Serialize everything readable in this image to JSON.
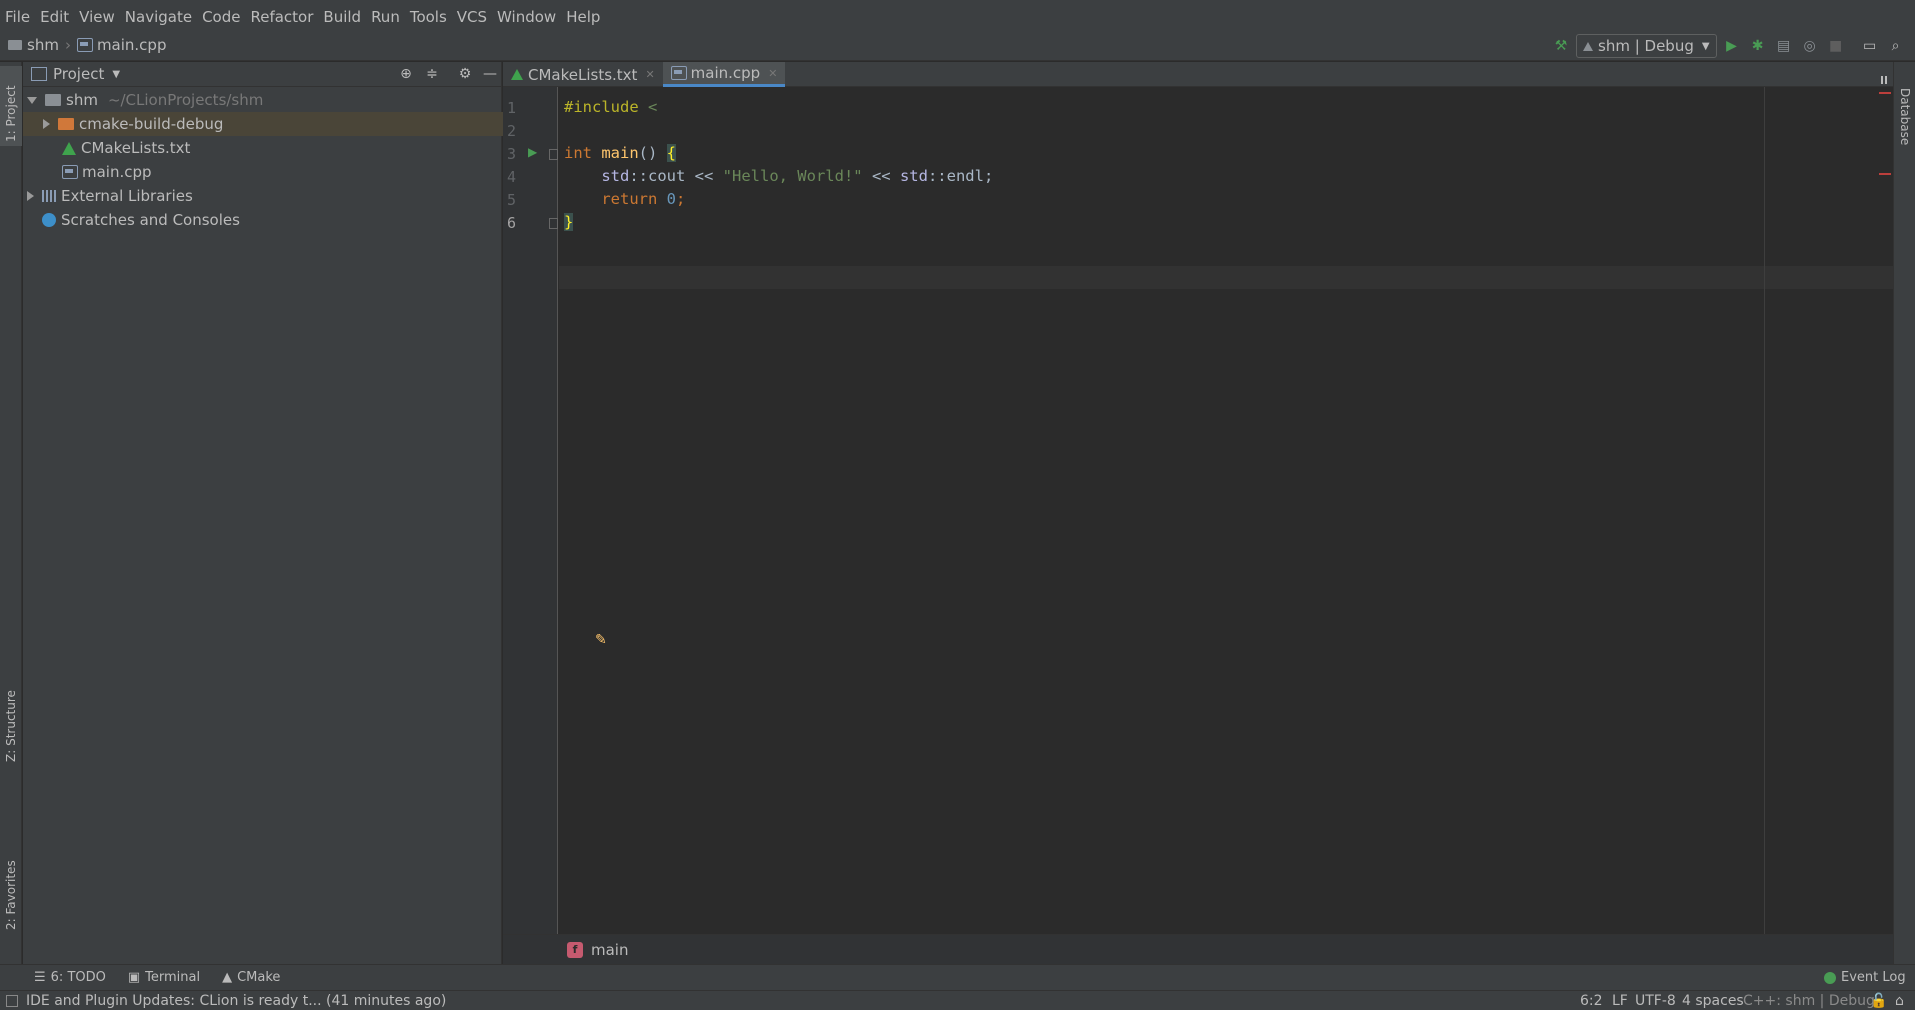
{
  "menu": [
    "File",
    "Edit",
    "View",
    "Navigate",
    "Code",
    "Refactor",
    "Build",
    "Run",
    "Tools",
    "VCS",
    "Window",
    "Help"
  ],
  "breadcrumb": {
    "project": "shm",
    "file": "main.cpp"
  },
  "run_config": "shm | Debug",
  "side_tabs": {
    "project": "1: Project",
    "structure": "Z: Structure",
    "favorites": "2: Favorites",
    "database": "Database"
  },
  "project_panel": {
    "title": "Project",
    "tree": [
      {
        "name": "shm",
        "hint": "~/CLionProjects/shm"
      },
      {
        "name": "cmake-build-debug"
      },
      {
        "name": "CMakeLists.txt"
      },
      {
        "name": "main.cpp"
      },
      {
        "name": "External Libraries"
      },
      {
        "name": "Scratches and Consoles"
      }
    ]
  },
  "tabs": [
    {
      "label": "CMakeLists.txt",
      "active": false
    },
    {
      "label": "main.cpp",
      "active": true
    }
  ],
  "code": {
    "line_numbers": [
      "1",
      "2",
      "3",
      "4",
      "5",
      "6"
    ],
    "l1_directive": "#include ",
    "l1_bracket": "<",
    "l3_kw": "int",
    "l3_fn": "main",
    "l3_rest": "() ",
    "l3_brace": "{",
    "l4_ns": "std",
    "l4_mid": "::cout << ",
    "l4_str": "\"Hello, World!\"",
    "l4_mid2": " << ",
    "l4_ns2": "std",
    "l4_end": "::endl;",
    "l5_kw": "return",
    "l5_num": "0",
    "l5_end": ";",
    "l6_brace": "}"
  },
  "editor_breadcrumb": {
    "icon": "f",
    "label": "main"
  },
  "tool_windows": [
    {
      "label": "6: TODO"
    },
    {
      "label": "Terminal"
    },
    {
      "label": "CMake"
    }
  ],
  "event_log": "Event Log",
  "status": {
    "message": "IDE and Plugin Updates: CLion is ready t... (41 minutes ago)",
    "position": "6:2",
    "line_sep": "LF",
    "encoding": "UTF-8",
    "indent": "4 spaces",
    "context": "C++: shm | Debug"
  },
  "colors": {
    "keyword": "#cc7832",
    "string": "#6a8759",
    "number": "#6897bb",
    "function": "#ffc66d",
    "namespace": "#b5b6e3",
    "text": "#a9b7c6",
    "accent_green": "#499c54"
  }
}
